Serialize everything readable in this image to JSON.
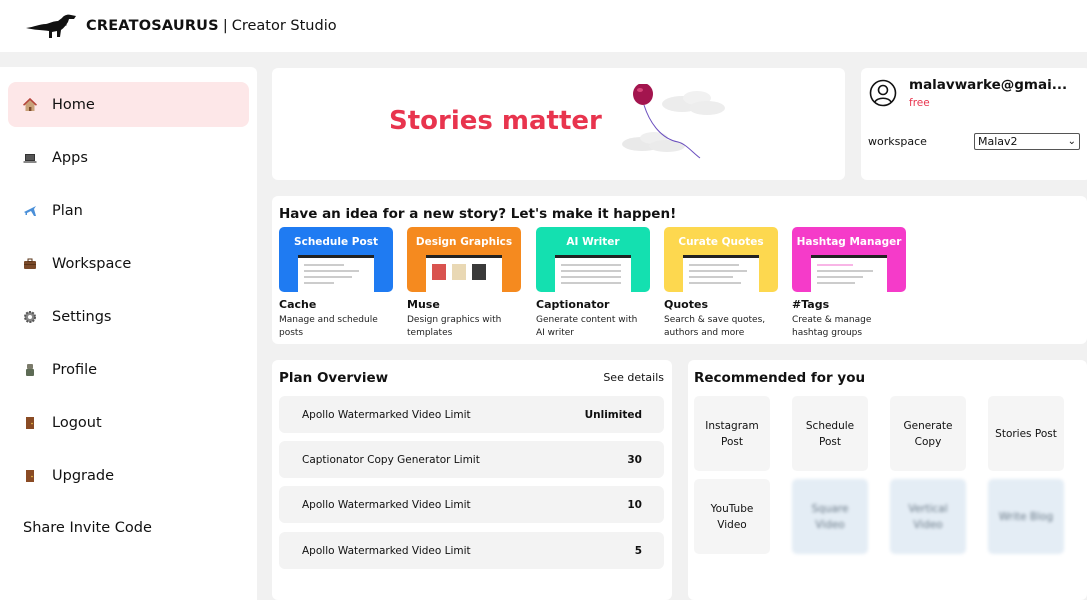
{
  "header": {
    "brand": "CREATOSAURUS",
    "separator": "|",
    "subtitle": "Creator Studio",
    "logo_icon": "dinosaur-icon"
  },
  "sidebar": {
    "items": [
      {
        "label": "Home",
        "icon": "house-icon",
        "active": true
      },
      {
        "label": "Apps",
        "icon": "laptop-icon"
      },
      {
        "label": "Plan",
        "icon": "airplane-icon"
      },
      {
        "label": "Workspace",
        "icon": "briefcase-icon"
      },
      {
        "label": "Settings",
        "icon": "gear-icon"
      },
      {
        "label": "Profile",
        "icon": "profile-icon"
      },
      {
        "label": "Logout",
        "icon": "door-icon"
      },
      {
        "label": "Upgrade",
        "icon": "door-icon"
      },
      {
        "label": "Share Invite Code"
      }
    ]
  },
  "banner": {
    "text": "Stories matter",
    "color": "#e8344e"
  },
  "user": {
    "email": "malavwarke@gmai...",
    "plan": "free",
    "workspace_label": "workspace",
    "workspace_value": "Malav2"
  },
  "ideas": {
    "title": "Have an idea for a new story? Let's make it happen!",
    "apps": [
      {
        "thumb_title": "Schedule Post",
        "name": "Cache",
        "desc": "Manage and schedule posts",
        "color": "#1f7bf2"
      },
      {
        "thumb_title": "Design Graphics",
        "name": "Muse",
        "desc": "Design graphics with templates",
        "color": "#f58a1f"
      },
      {
        "thumb_title": "AI Writer",
        "name": "Captionator",
        "desc": "Generate content with AI writer",
        "color": "#14e0b0"
      },
      {
        "thumb_title": "Curate Quotes",
        "name": "Quotes",
        "desc": "Search & save quotes, authors and more",
        "color": "#fdd84f"
      },
      {
        "thumb_title": "Hashtag Manager",
        "name": "#Tags",
        "desc": "Create & manage hashtag groups",
        "color": "#f53bc9"
      }
    ]
  },
  "plan": {
    "title": "Plan Overview",
    "link": "See details",
    "rows": [
      {
        "name": "Apollo Watermarked Video Limit",
        "value": "Unlimited"
      },
      {
        "name": "Captionator Copy Generator Limit",
        "value": "30"
      },
      {
        "name": "Apollo Watermarked Video Limit",
        "value": "10"
      },
      {
        "name": "Apollo Watermarked Video Limit",
        "value": "5"
      }
    ]
  },
  "recommended": {
    "title": "Recommended for you",
    "tiles": [
      {
        "label": "Instagram Post"
      },
      {
        "label": "Schedule Post"
      },
      {
        "label": "Generate Copy"
      },
      {
        "label": "Stories Post"
      },
      {
        "label": "YouTube Video"
      },
      {
        "label": "Square Video",
        "locked": true
      },
      {
        "label": "Vertical Video",
        "locked": true
      },
      {
        "label": "Write Blog",
        "locked": true
      }
    ]
  }
}
